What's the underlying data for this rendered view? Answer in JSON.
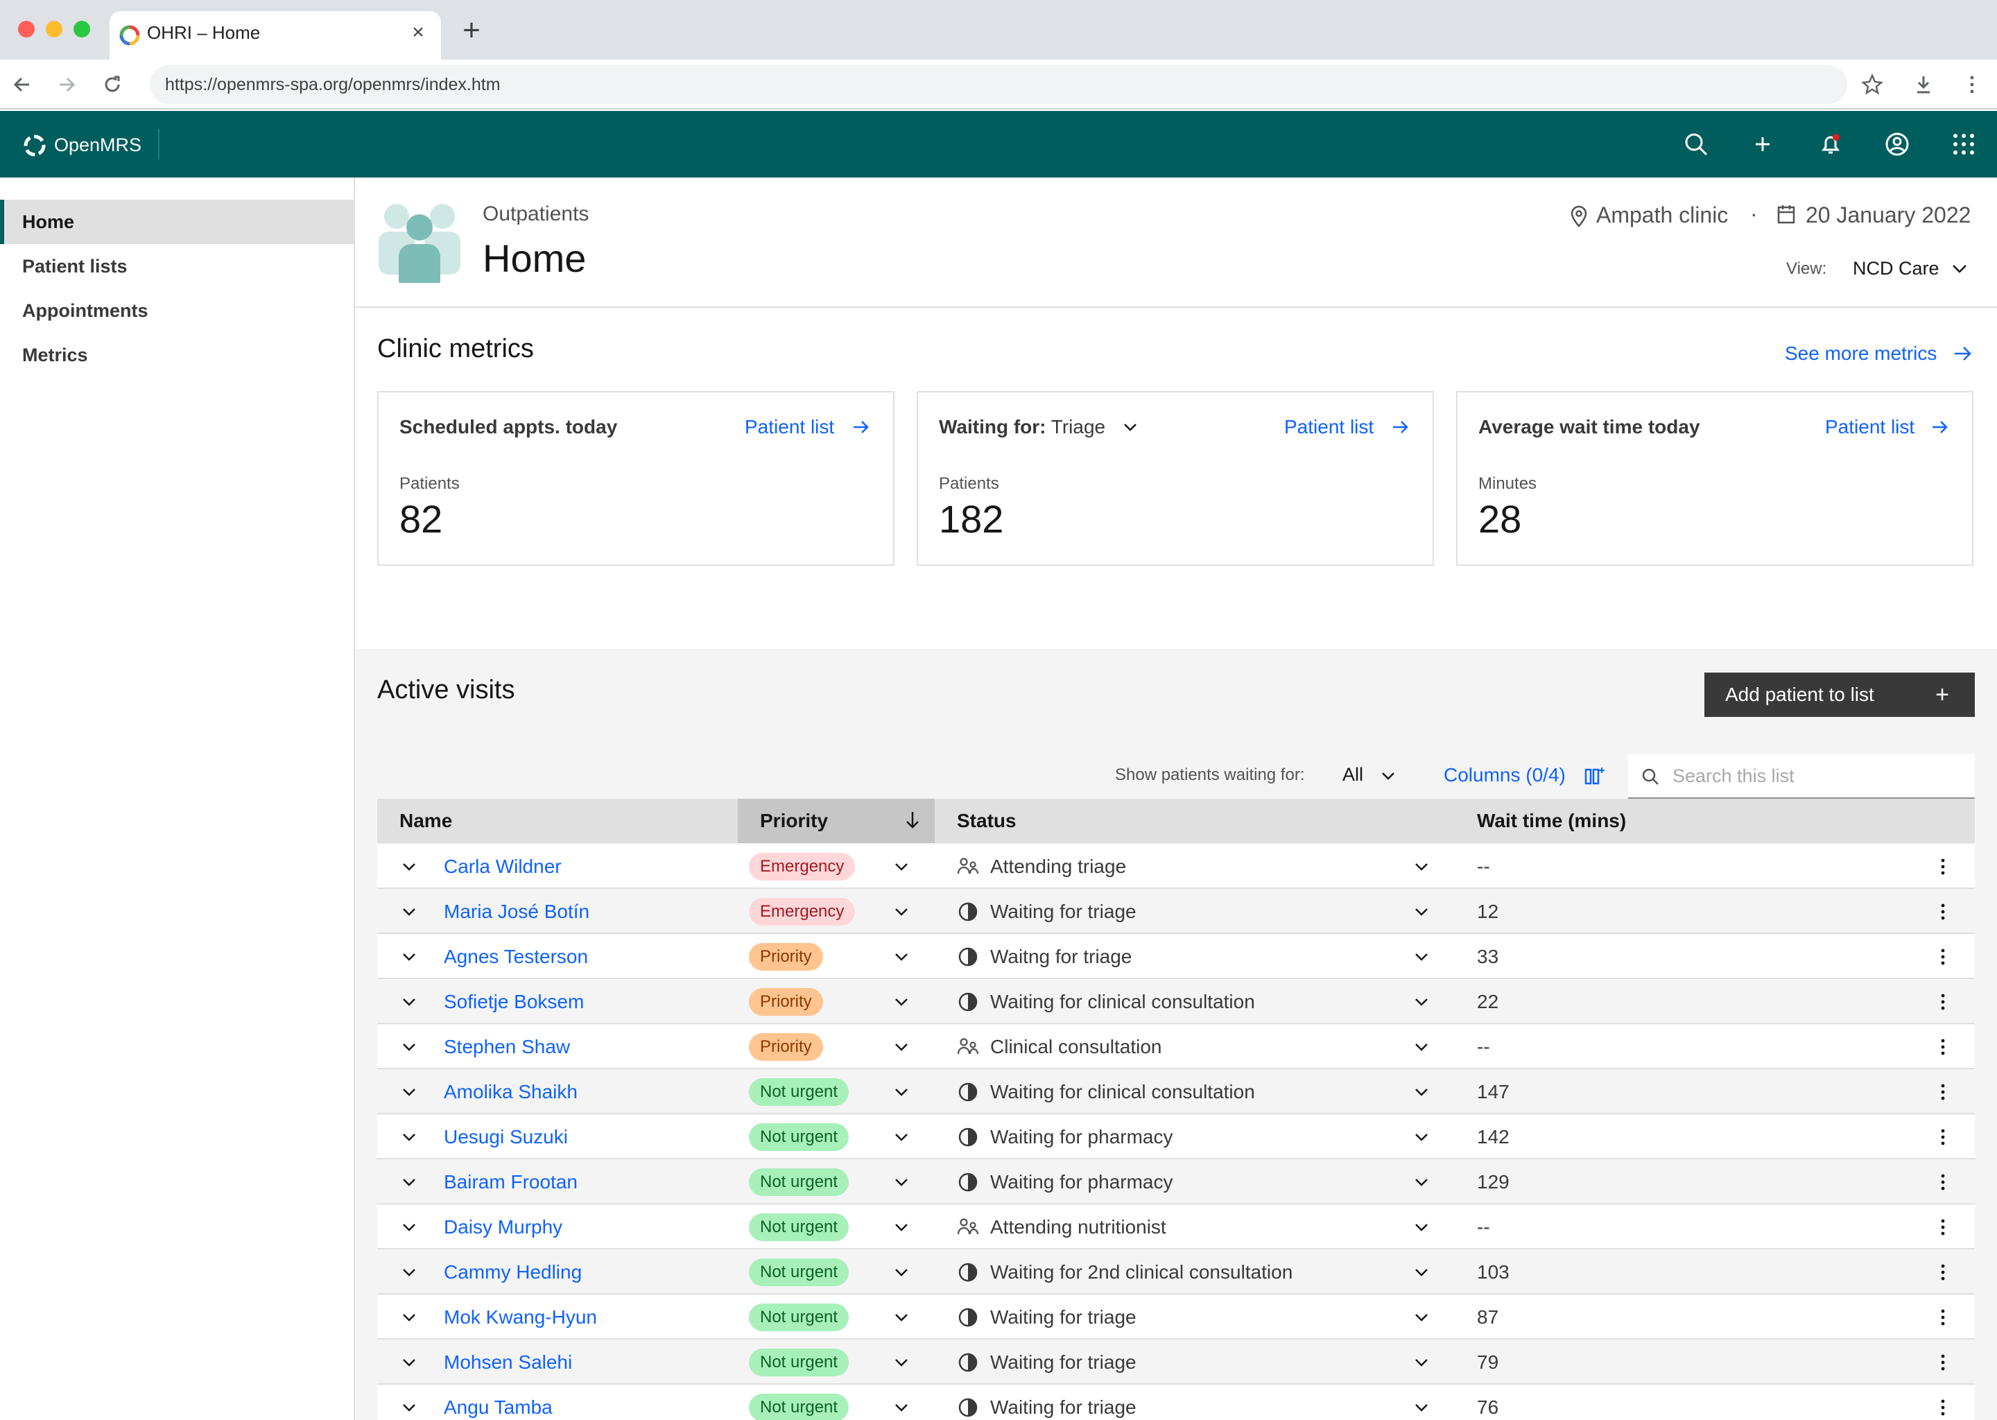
{
  "browser": {
    "tab_title": "OHRI – Home",
    "url": "https://openmrs-spa.org/openmrs/index.htm"
  },
  "app": {
    "brand": "OpenMRS",
    "header_icons": [
      "search-icon",
      "add-icon",
      "notification-icon",
      "user-icon",
      "app-switcher-icon"
    ],
    "colors": {
      "header": "#005d5d",
      "link": "#0f62fe",
      "emergency_bg": "#ffd7d9",
      "priority_bg": "#ffc48f",
      "not_urgent_bg": "#a7f0ba"
    }
  },
  "sidebar": {
    "items": [
      {
        "label": "Home",
        "active": true
      },
      {
        "label": "Patient lists",
        "active": false
      },
      {
        "label": "Appointments",
        "active": false
      },
      {
        "label": "Metrics",
        "active": false
      }
    ]
  },
  "page_header": {
    "subtitle": "Outpatients",
    "title": "Home",
    "location": "Ampath clinic",
    "separator": "·",
    "date": "20 January 2022",
    "view_label": "View:",
    "view_value": "NCD Care"
  },
  "metrics": {
    "title": "Clinic metrics",
    "see_more": "See more metrics",
    "cards": [
      {
        "title": "Scheduled appts. today",
        "link": "Patient list",
        "label": "Patients",
        "value": "82"
      },
      {
        "title": "Waiting for:",
        "title_value": "Triage",
        "link": "Patient list",
        "label": "Patients",
        "value": "182"
      },
      {
        "title": "Average wait time today",
        "link": "Patient list",
        "label": "Minutes",
        "value": "28"
      }
    ]
  },
  "visits": {
    "title": "Active visits",
    "add_button": "Add patient to list",
    "filter_label": "Show patients waiting for:",
    "filter_value": "All",
    "columns_link": "Columns (0/4)",
    "search_placeholder": "Search this list",
    "headers": {
      "name": "Name",
      "priority": "Priority",
      "status": "Status",
      "wait": "Wait time (mins)"
    },
    "rows": [
      {
        "name": "Carla Wildner",
        "priority": "Emergency",
        "status": "Attending triage",
        "status_icon": "people-icon",
        "wait": "--"
      },
      {
        "name": "Maria José Botín",
        "priority": "Emergency",
        "status": "Waiting for triage",
        "status_icon": "pending-icon",
        "wait": "12"
      },
      {
        "name": "Agnes Testerson",
        "priority": "Priority",
        "status": "Waitng for triage",
        "status_icon": "pending-icon",
        "wait": "33"
      },
      {
        "name": "Sofietje Boksem",
        "priority": "Priority",
        "status": "Waiting for clinical consultation",
        "status_icon": "pending-icon",
        "wait": "22"
      },
      {
        "name": "Stephen Shaw",
        "priority": "Priority",
        "status": "Clinical consultation",
        "status_icon": "people-icon",
        "wait": "--"
      },
      {
        "name": "Amolika Shaikh",
        "priority": "Not urgent",
        "status": "Waiting for clinical consultation",
        "status_icon": "pending-icon",
        "wait": "147"
      },
      {
        "name": "Uesugi Suzuki",
        "priority": "Not urgent",
        "status": "Waiting for pharmacy",
        "status_icon": "pending-icon",
        "wait": "142"
      },
      {
        "name": "Bairam Frootan",
        "priority": "Not urgent",
        "status": "Waiting for pharmacy",
        "status_icon": "pending-icon",
        "wait": "129"
      },
      {
        "name": "Daisy Murphy",
        "priority": "Not urgent",
        "status": "Attending nutritionist",
        "status_icon": "people-icon",
        "wait": "--"
      },
      {
        "name": "Cammy Hedling",
        "priority": "Not urgent",
        "status": "Waiting for 2nd clinical consultation",
        "status_icon": "pending-icon",
        "wait": "103"
      },
      {
        "name": "Mok Kwang-Hyun",
        "priority": "Not urgent",
        "status": "Waiting for triage",
        "status_icon": "pending-icon",
        "wait": "87"
      },
      {
        "name": "Mohsen Salehi",
        "priority": "Not urgent",
        "status": "Waiting for triage",
        "status_icon": "pending-icon",
        "wait": "79"
      },
      {
        "name": "Angu Tamba",
        "priority": "Not urgent",
        "status": "Waiting for triage",
        "status_icon": "pending-icon",
        "wait": "76"
      }
    ]
  }
}
